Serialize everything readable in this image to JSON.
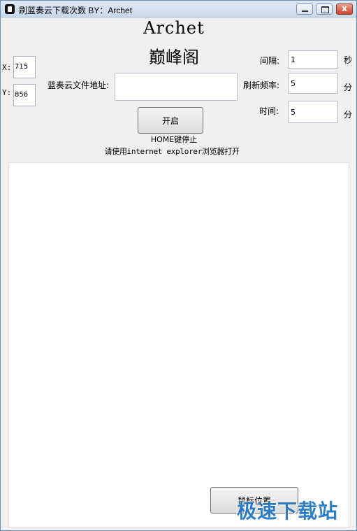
{
  "window": {
    "title": "刷蓝奏云下载次数 BY：Archet",
    "close_glyph": "x"
  },
  "brand": {
    "line1": "Archet",
    "line2": "巅峰阁"
  },
  "coords": {
    "x_label": "X:",
    "x_value": "715",
    "y_label": "Y:",
    "y_value": "856"
  },
  "url": {
    "label": "蓝奏云文件地址:",
    "value": ""
  },
  "settings": {
    "interval_label": "间隔:",
    "interval_value": "1",
    "interval_unit": "秒",
    "refresh_label": "刷新频率:",
    "refresh_value": "5",
    "refresh_unit": "分",
    "time_label": "时间:",
    "time_value": "5",
    "time_unit": "分"
  },
  "actions": {
    "start_label": "开启",
    "mouse_position_label": "鼠标位置"
  },
  "notes": {
    "home_stop": "HOME键停止",
    "browser_hint": "请使用internet explorer浏览器打开"
  },
  "watermark": "极速下载站"
}
